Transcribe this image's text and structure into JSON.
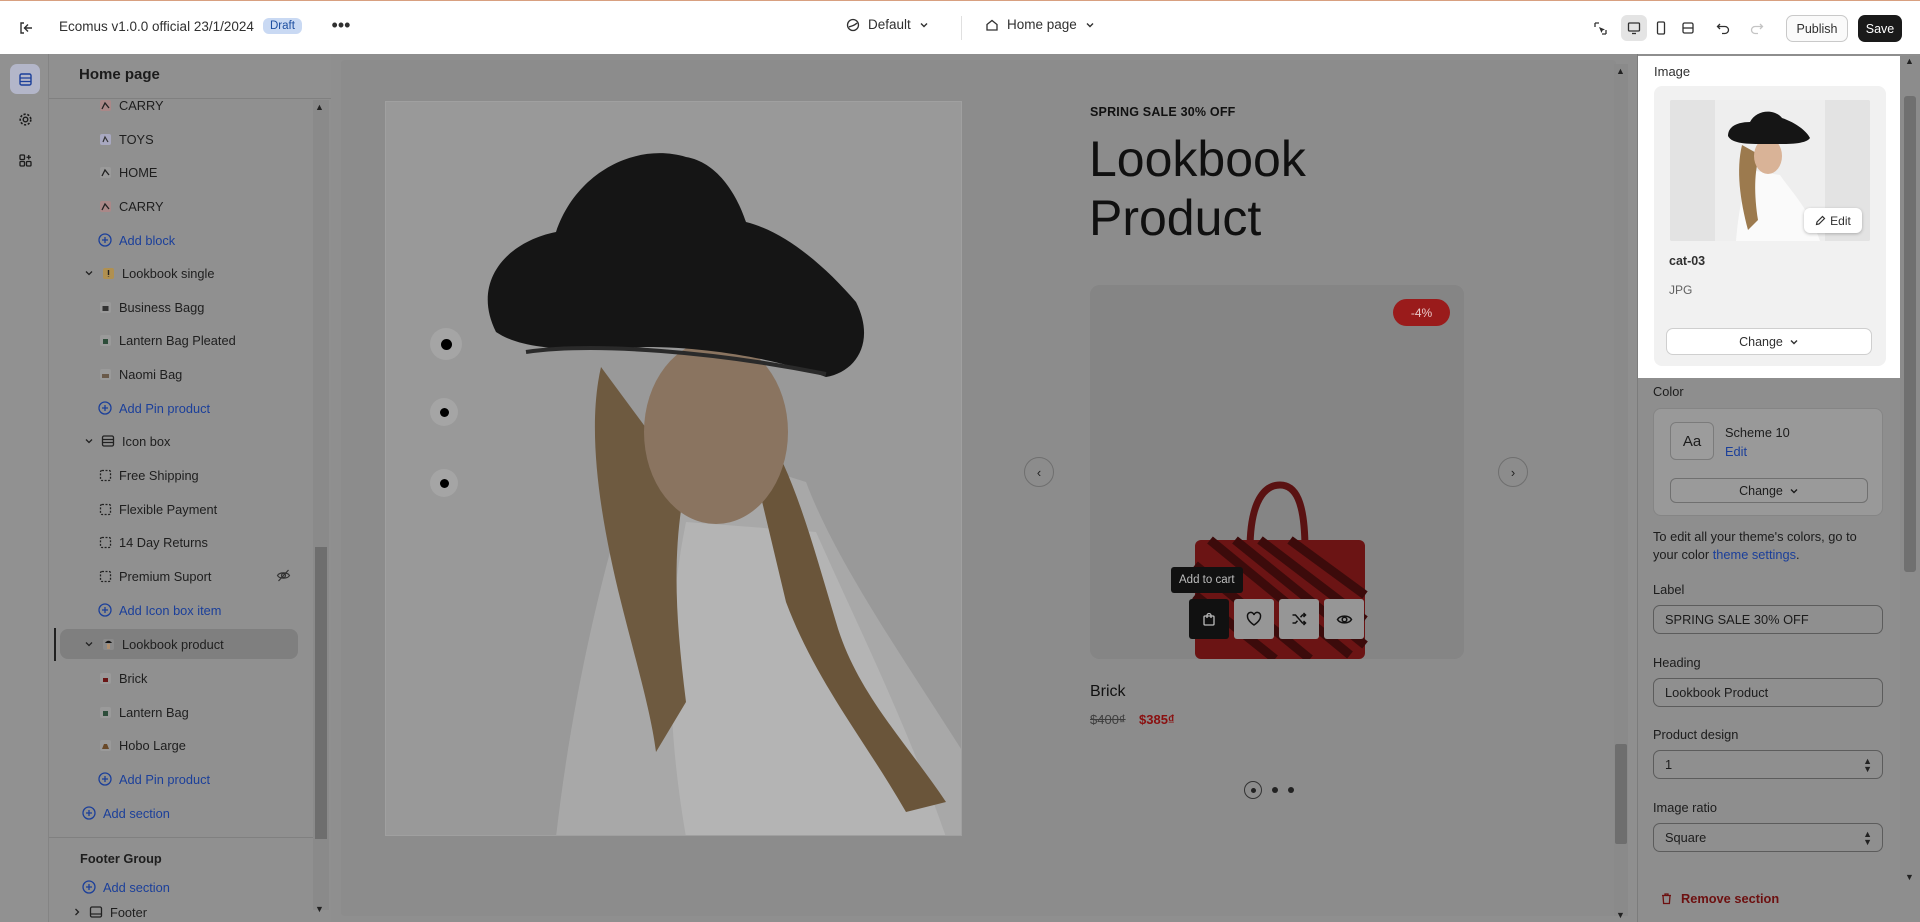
{
  "topbar": {
    "store_title": "Ecomus v1.0.0 official 23/1/2024",
    "status_badge": "Draft",
    "more": "•••",
    "theme_select": "Default",
    "page_select": "Home page",
    "publish_label": "Publish",
    "save_label": "Save"
  },
  "sidebar": {
    "title": "Home page",
    "items": [
      {
        "label": "CARRY"
      },
      {
        "label": "TOYS"
      },
      {
        "label": "HOME"
      },
      {
        "label": "CARRY"
      },
      {
        "label": "Add block"
      },
      {
        "label": "Lookbook single"
      },
      {
        "label": "Business Bagg"
      },
      {
        "label": "Lantern Bag Pleated"
      },
      {
        "label": "Naomi Bag"
      },
      {
        "label": "Add Pin product"
      },
      {
        "label": "Icon box"
      },
      {
        "label": "Free Shipping"
      },
      {
        "label": "Flexible Payment"
      },
      {
        "label": "14 Day Returns"
      },
      {
        "label": "Premium Suport"
      },
      {
        "label": "Add Icon box item"
      },
      {
        "label": "Lookbook product"
      },
      {
        "label": "Brick"
      },
      {
        "label": "Lantern Bag"
      },
      {
        "label": "Hobo Large"
      },
      {
        "label": "Add Pin product"
      },
      {
        "label": "Add section"
      }
    ],
    "footer_group_title": "Footer Group",
    "footer_add_section": "Add section",
    "footer_item": "Footer"
  },
  "preview": {
    "sale_label": "SPRING SALE 30% OFF",
    "heading": "Lookbook Product",
    "discount_badge": "-4%",
    "tooltip": "Add to cart",
    "product_name": "Brick",
    "price_old": "$400₫",
    "price_new": "$385₫"
  },
  "settings": {
    "image_label": "Image",
    "image_name": "cat-03",
    "image_type": "JPG",
    "edit_label": "Edit",
    "image_change": "Change",
    "color_label": "Color",
    "aa": "Aa",
    "scheme_name": "Scheme 10",
    "scheme_edit": "Edit",
    "color_change": "Change",
    "help_text_prefix": "To edit all your theme's colors, go to your color ",
    "help_text_link": "theme settings",
    "help_text_suffix": ".",
    "label_field_label": "Label",
    "label_field_value": "SPRING SALE 30% OFF",
    "heading_field_label": "Heading",
    "heading_field_value": "Lookbook Product",
    "product_design_label": "Product design",
    "product_design_value": "1",
    "image_ratio_label": "Image ratio",
    "image_ratio_value": "Square",
    "remove_section": "Remove section"
  },
  "colors": {
    "accent": "#1b3f9a",
    "sale_red": "#9a1b1b",
    "save_bg": "#1a1a1a"
  }
}
